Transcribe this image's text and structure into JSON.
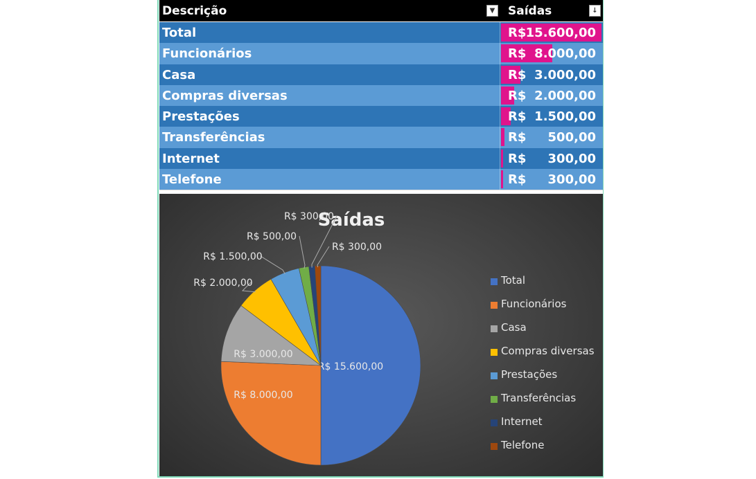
{
  "table": {
    "headers": {
      "description": "Descrição",
      "outflows": "Saídas"
    },
    "rows": [
      {
        "label": "Total",
        "currency": "R$",
        "amount": "15.600,00",
        "value": 15600
      },
      {
        "label": "Funcionários",
        "currency": "R$",
        "amount": "8.000,00",
        "value": 8000
      },
      {
        "label": "Casa",
        "currency": "R$",
        "amount": "3.000,00",
        "value": 3000
      },
      {
        "label": "Compras diversas",
        "currency": "R$",
        "amount": "2.000,00",
        "value": 2000
      },
      {
        "label": "Prestações",
        "currency": "R$",
        "amount": "1.500,00",
        "value": 1500
      },
      {
        "label": "Transferências",
        "currency": "R$",
        "amount": "500,00",
        "value": 500
      },
      {
        "label": "Internet",
        "currency": "R$",
        "amount": "300,00",
        "value": 300
      },
      {
        "label": "Telefone",
        "currency": "R$",
        "amount": "300,00",
        "value": 300
      }
    ],
    "bar_color": "#e0148c",
    "dark_row_color": "#2e75b6",
    "light_row_color": "#5b9bd5",
    "filter_icon": "dropdown-arrow-icon",
    "sort_icon": "sort-descending-icon"
  },
  "chart_data": {
    "type": "pie",
    "title": "Saídas",
    "categories": [
      "Total",
      "Funcionários",
      "Casa",
      "Compras diversas",
      "Prestações",
      "Transferências",
      "Internet",
      "Telefone"
    ],
    "values": [
      15600,
      8000,
      3000,
      2000,
      1500,
      500,
      300,
      300
    ],
    "data_labels": [
      "R$ 15.600,00",
      "R$ 8.000,00",
      "R$ 3.000,00",
      "R$ 2.000,00",
      "R$ 1.500,00",
      "R$ 500,00",
      "R$ 300,00",
      "R$ 300,00"
    ],
    "colors": [
      "#4472c4",
      "#ed7d31",
      "#a5a5a5",
      "#ffc000",
      "#5b9bd5",
      "#70ad47",
      "#264478",
      "#9e480e"
    ],
    "legend_position": "right"
  }
}
